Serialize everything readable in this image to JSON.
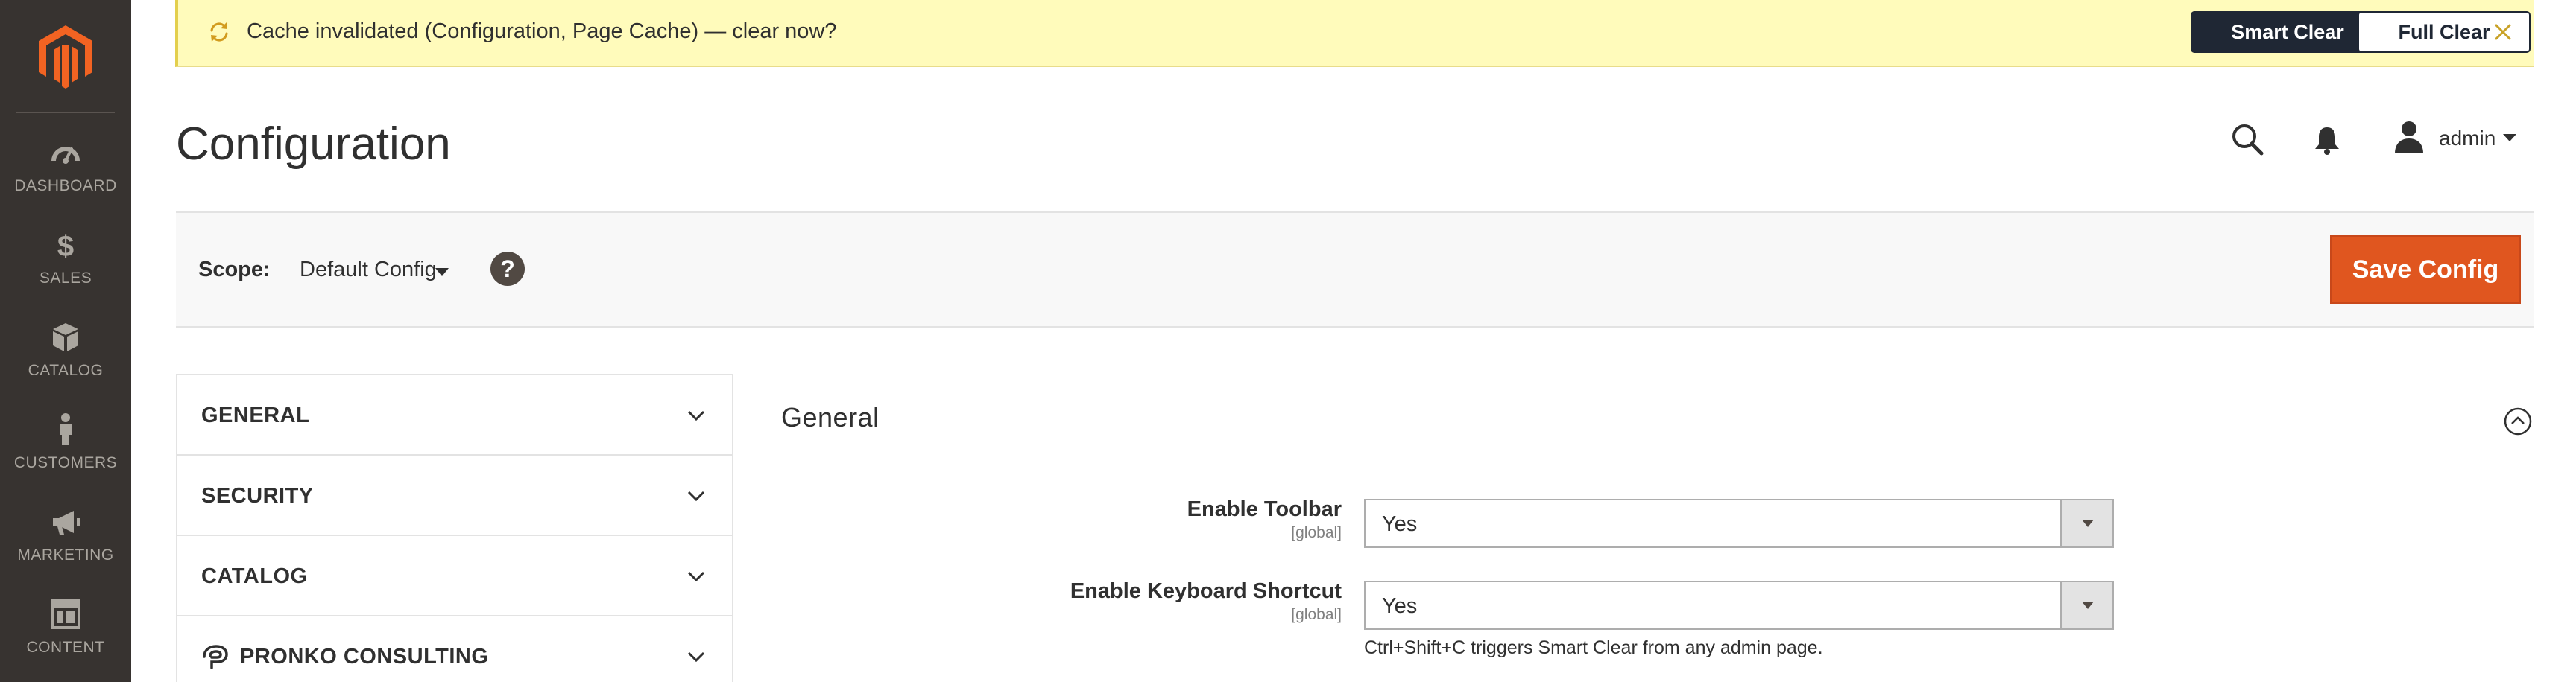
{
  "sidebar": {
    "items": [
      {
        "label": "DASHBOARD",
        "icon": "dashboard-icon"
      },
      {
        "label": "SALES",
        "icon": "dollar-icon"
      },
      {
        "label": "CATALOG",
        "icon": "catalog-box-icon"
      },
      {
        "label": "CUSTOMERS",
        "icon": "customer-person-icon"
      },
      {
        "label": "MARKETING",
        "icon": "megaphone-icon"
      },
      {
        "label": "CONTENT",
        "icon": "content-layout-icon"
      }
    ]
  },
  "banner": {
    "message": "Cache invalidated (Configuration, Page Cache) — clear now?",
    "smart_clear_label": "Smart Clear",
    "full_clear_label": "Full Clear"
  },
  "header": {
    "title": "Configuration",
    "username": "admin"
  },
  "scope": {
    "label": "Scope:",
    "value": "Default Config",
    "help": "?",
    "save_label": "Save Config"
  },
  "tabs": [
    {
      "label": "GENERAL"
    },
    {
      "label": "SECURITY"
    },
    {
      "label": "CATALOG"
    },
    {
      "label": "PRONKO CONSULTING"
    }
  ],
  "section": {
    "title": "General",
    "fields": [
      {
        "label": "Enable Toolbar",
        "scope": "[global]",
        "value": "Yes"
      },
      {
        "label": "Enable Keyboard Shortcut",
        "scope": "[global]",
        "value": "Yes",
        "note": "Ctrl+Shift+C triggers Smart Clear from any admin page."
      }
    ]
  },
  "colors": {
    "sidebar_bg": "#373330",
    "banner_bg": "#fffbbb",
    "save_button": "#e0561f",
    "dark_button": "#1f2734",
    "logo": "#f26322"
  }
}
